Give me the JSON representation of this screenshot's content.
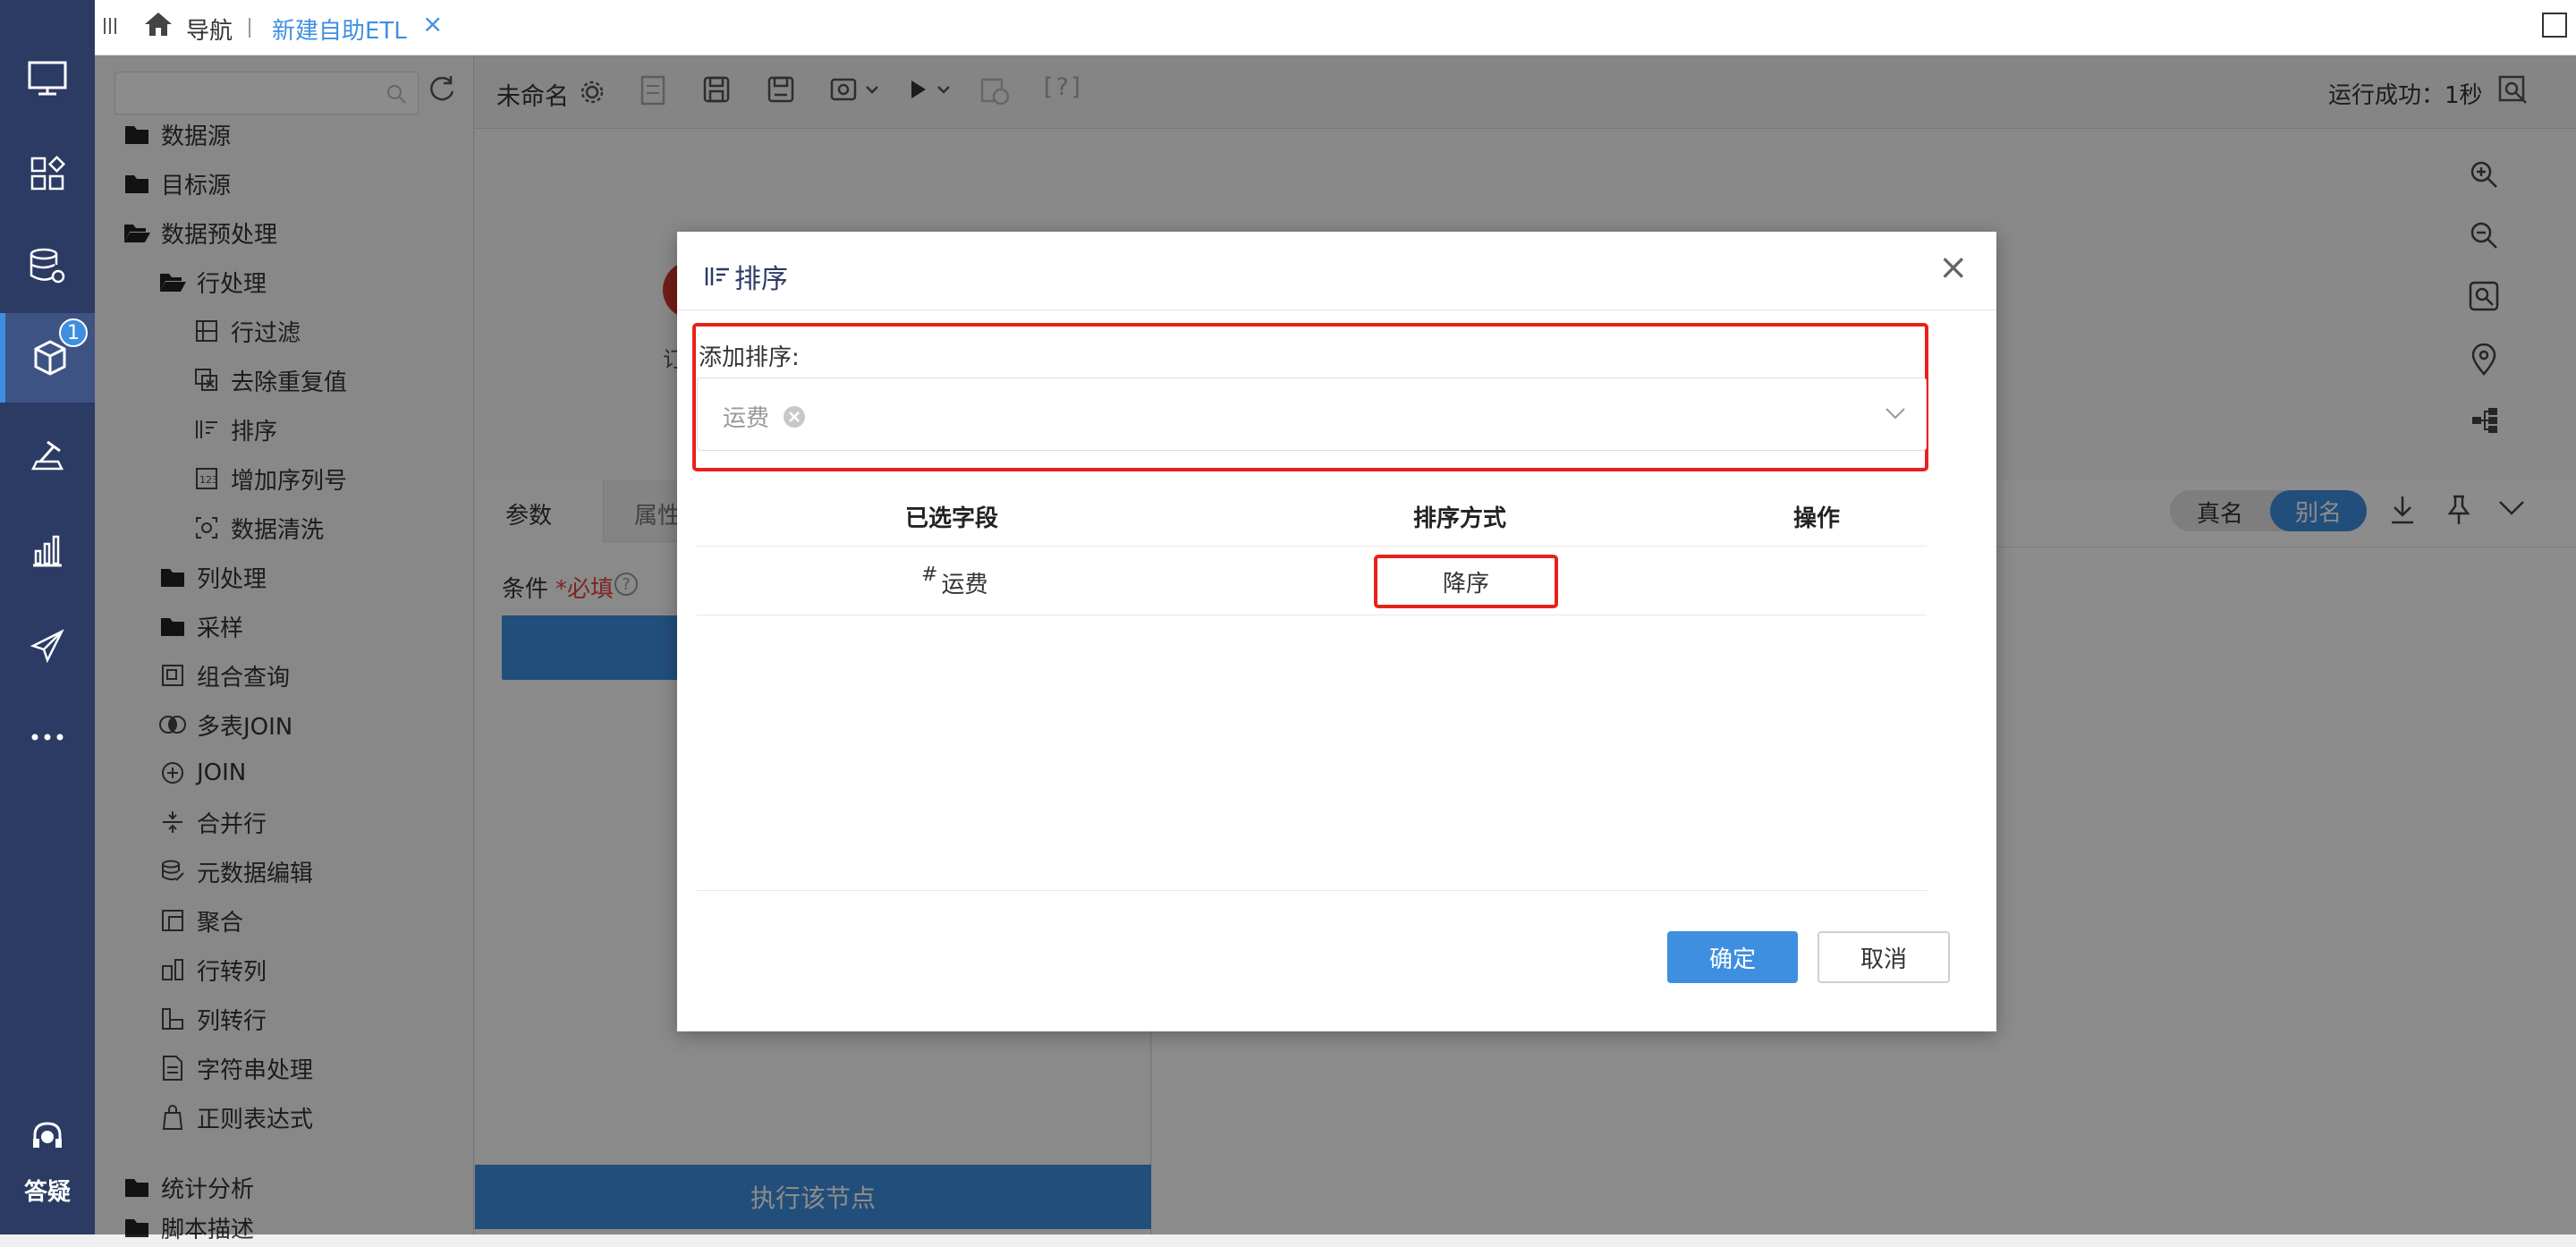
{
  "tabbar": {
    "nav_label": "导航",
    "active_tab": "新建自助ETL",
    "close": "×"
  },
  "leftnav": {
    "badge": "1",
    "help_label": "答疑"
  },
  "tree": {
    "items": [
      {
        "label": "数据源"
      },
      {
        "label": "目标源"
      },
      {
        "label": "数据预处理"
      },
      {
        "label": "行处理"
      },
      {
        "label": "行过滤"
      },
      {
        "label": "去除重复值"
      },
      {
        "label": "排序"
      },
      {
        "label": "增加序列号"
      },
      {
        "label": "数据清洗"
      },
      {
        "label": "列处理"
      },
      {
        "label": "采样"
      },
      {
        "label": "组合查询"
      },
      {
        "label": "多表JOIN"
      },
      {
        "label": "JOIN"
      },
      {
        "label": "合并行"
      },
      {
        "label": "元数据编辑"
      },
      {
        "label": "聚合"
      },
      {
        "label": "行转列"
      },
      {
        "label": "列转行"
      },
      {
        "label": "字符串处理"
      },
      {
        "label": "正则表达式"
      },
      {
        "label": "统计分析"
      },
      {
        "label": "脚本描述"
      }
    ]
  },
  "toolbar": {
    "name": "未命名",
    "help": "[?]",
    "status": "运行成功：1秒"
  },
  "canvas": {
    "node_label_partial": "订"
  },
  "params": {
    "tab1": "参数",
    "tab2": "属性",
    "cond_label": "条件",
    "required": "*必填",
    "info": "?"
  },
  "data_panel": {
    "real_name": "真名",
    "alias": "别名"
  },
  "exec_button": "执行该节点",
  "dialog": {
    "title": "排序",
    "add_label": "添加排序:",
    "selected_tag": "运费",
    "columns": [
      "已选字段",
      "排序方式",
      "操作"
    ],
    "rows": [
      {
        "field_prefix": "#",
        "field": "运费",
        "order": "降序"
      }
    ],
    "ok": "确定",
    "cancel": "取消",
    "close": "×"
  },
  "colors": {
    "nav_bg": "#2b3b63",
    "accent": "#3f8fe0",
    "highlight": "#e8211b"
  }
}
